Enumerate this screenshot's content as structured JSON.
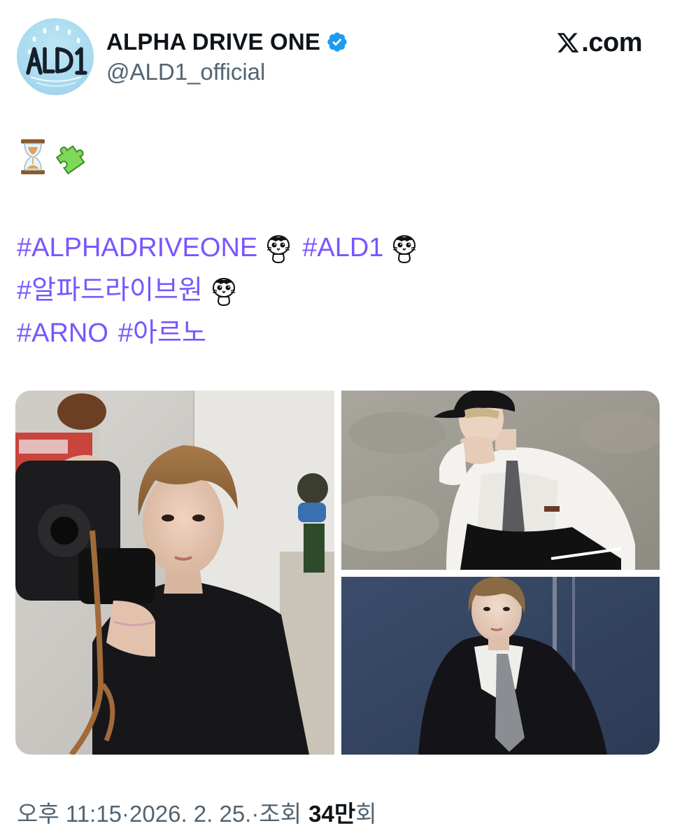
{
  "author": {
    "display_name": "ALPHA DRIVE ONE",
    "handle": "@ALD1_official",
    "verified": true,
    "verified_icon": "verified-badge-icon",
    "avatar_icon": "ald1-logo-avatar",
    "avatar_logo_text": "ALD1"
  },
  "brand": {
    "logo_icon": "x-logo-icon",
    "text": ".com"
  },
  "tweet": {
    "emoji_icons": [
      "hourglass-icon",
      "puzzle-piece-icon"
    ],
    "hashtag_lines": [
      [
        {
          "text": "#ALPHADRIVEONE",
          "hashflag": true
        },
        {
          "text": "#ALD1",
          "hashflag": true
        }
      ],
      [
        {
          "text": "#알파드라이브원",
          "hashflag": true
        }
      ],
      [
        {
          "text": "#ARNO",
          "hashflag": false
        },
        {
          "text": "#아르노",
          "hashflag": false
        }
      ]
    ],
    "tags": {
      "t1": "#ALPHADRIVEONE",
      "t2": "#ALD1",
      "t3": "#알파드라이브원",
      "t4": "#ARNO",
      "t5": "#아르노"
    },
    "link_color": "#7856ff",
    "media": [
      {
        "alt_icon": "photo-camera-portrait"
      },
      {
        "alt_icon": "photo-crouching-portrait"
      },
      {
        "alt_icon": "photo-blue-wall-portrait"
      }
    ]
  },
  "meta": {
    "time": "오후 11:15",
    "separator": " · ",
    "date": "2026. 2. 25.",
    "views_label": "조회",
    "views_number": "34",
    "views_unit": "만회"
  },
  "colors": {
    "text_primary": "#0f1419",
    "text_secondary": "#536471",
    "verified_blue": "#1d9bf0",
    "hashtag": "#7856ff"
  }
}
